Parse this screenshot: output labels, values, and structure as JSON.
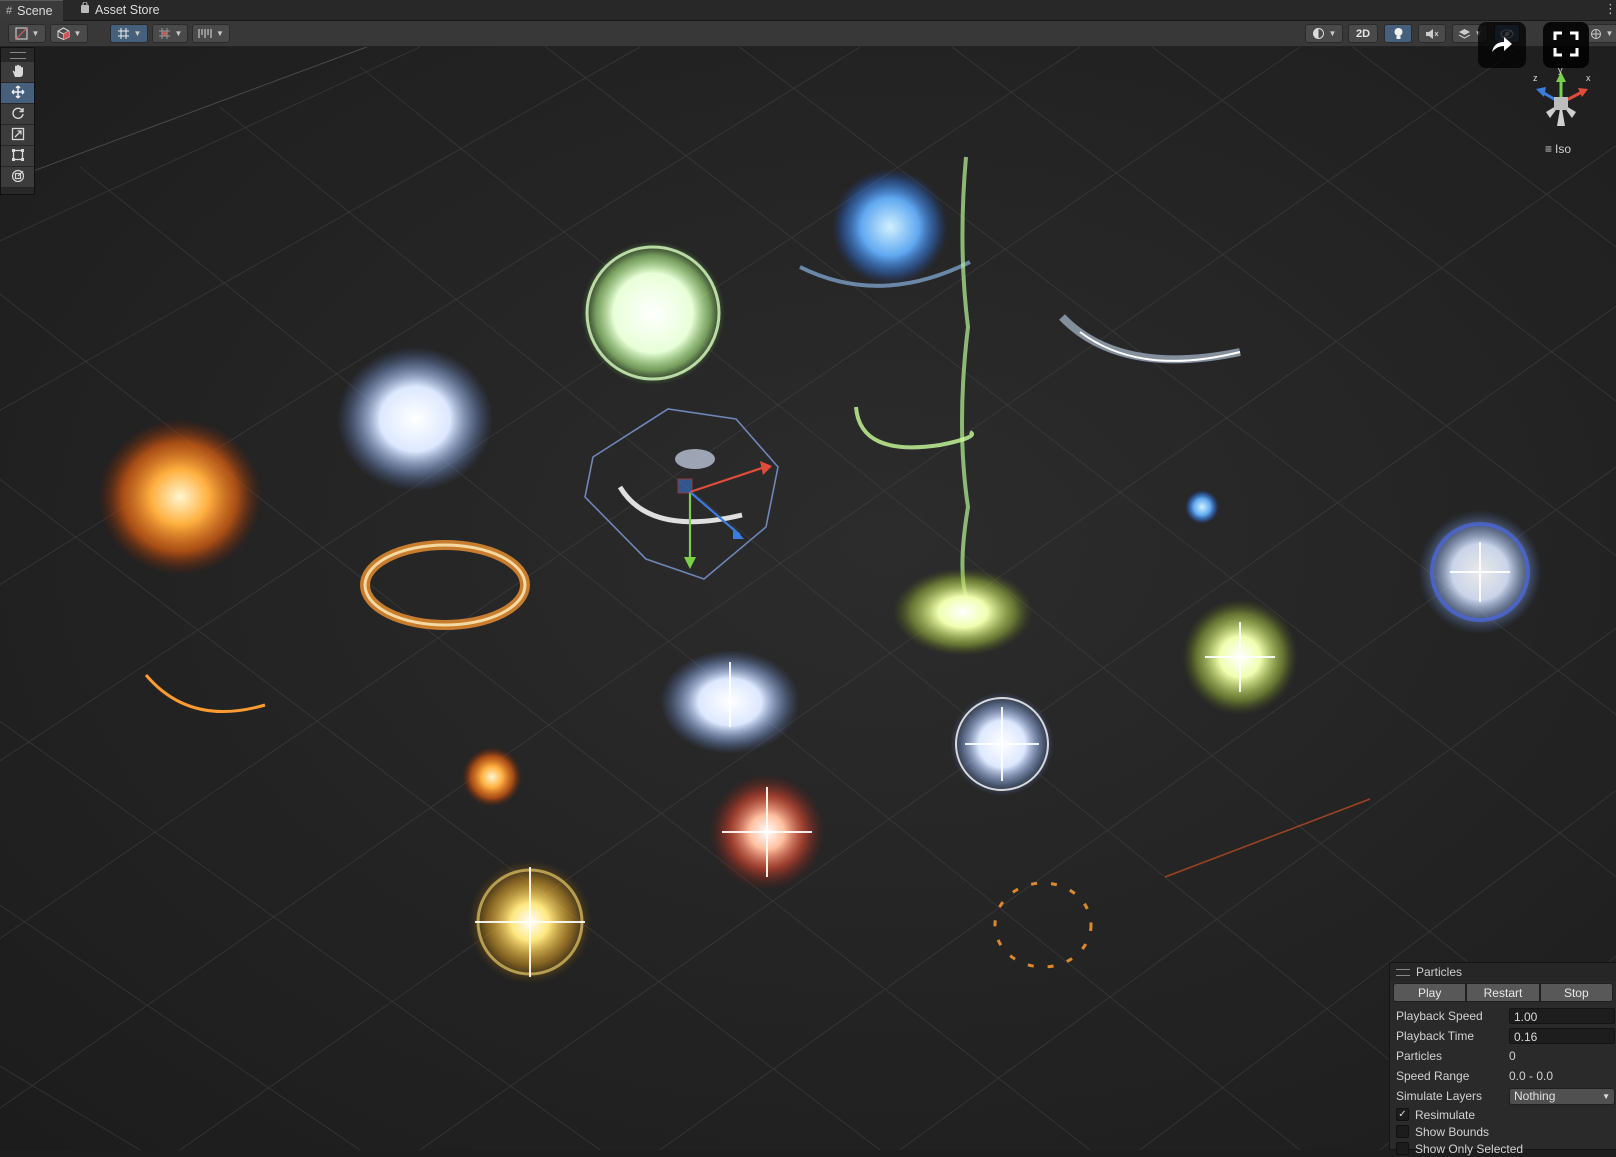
{
  "tabs": [
    {
      "label": "Scene",
      "icon": "grid-icon"
    },
    {
      "label": "Asset Store",
      "icon": "shopping-bag-icon"
    }
  ],
  "toolbar": {
    "view_2d_label": "2D",
    "icons": [
      "draw-mode-icon",
      "render-cube-icon",
      "grid-snap-icon",
      "increment-snap-icon",
      "ruler-icon",
      "shading-sphere-icon",
      "lighting-bulb-icon",
      "audio-mute-icon",
      "effects-layers-icon",
      "visibility-icon",
      "gizmos-icon"
    ]
  },
  "tools": [
    "hand-tool-icon",
    "move-tool-icon",
    "rotate-tool-icon",
    "scale-tool-icon",
    "rect-tool-icon",
    "transform-tool-icon"
  ],
  "active_tool": "move-tool-icon",
  "gizmo": {
    "projection_label": "Iso",
    "axes": [
      "z",
      "y",
      "x"
    ],
    "colors": {
      "x": "#e04c3a",
      "y": "#7ad04a",
      "z": "#3a7ce0"
    }
  },
  "particles": {
    "title": "Particles",
    "buttons": {
      "play": "Play",
      "restart": "Restart",
      "stop": "Stop"
    },
    "rows": [
      {
        "label": "Playback Speed",
        "value": "1.00"
      },
      {
        "label": "Playback Time",
        "value": "0.16"
      },
      {
        "label": "Particles",
        "value": "0"
      },
      {
        "label": "Speed Range",
        "value": "0.0 - 0.0"
      }
    ],
    "simulate_layers": {
      "label": "Simulate Layers",
      "value": "Nothing"
    },
    "checks": [
      {
        "label": "Resimulate",
        "checked": true
      },
      {
        "label": "Show Bounds",
        "checked": false
      },
      {
        "label": "Show Only Selected",
        "checked": false
      }
    ]
  },
  "colors": {
    "accent": "#46607c",
    "background": "#1e1e1e",
    "panel": "#383838"
  }
}
